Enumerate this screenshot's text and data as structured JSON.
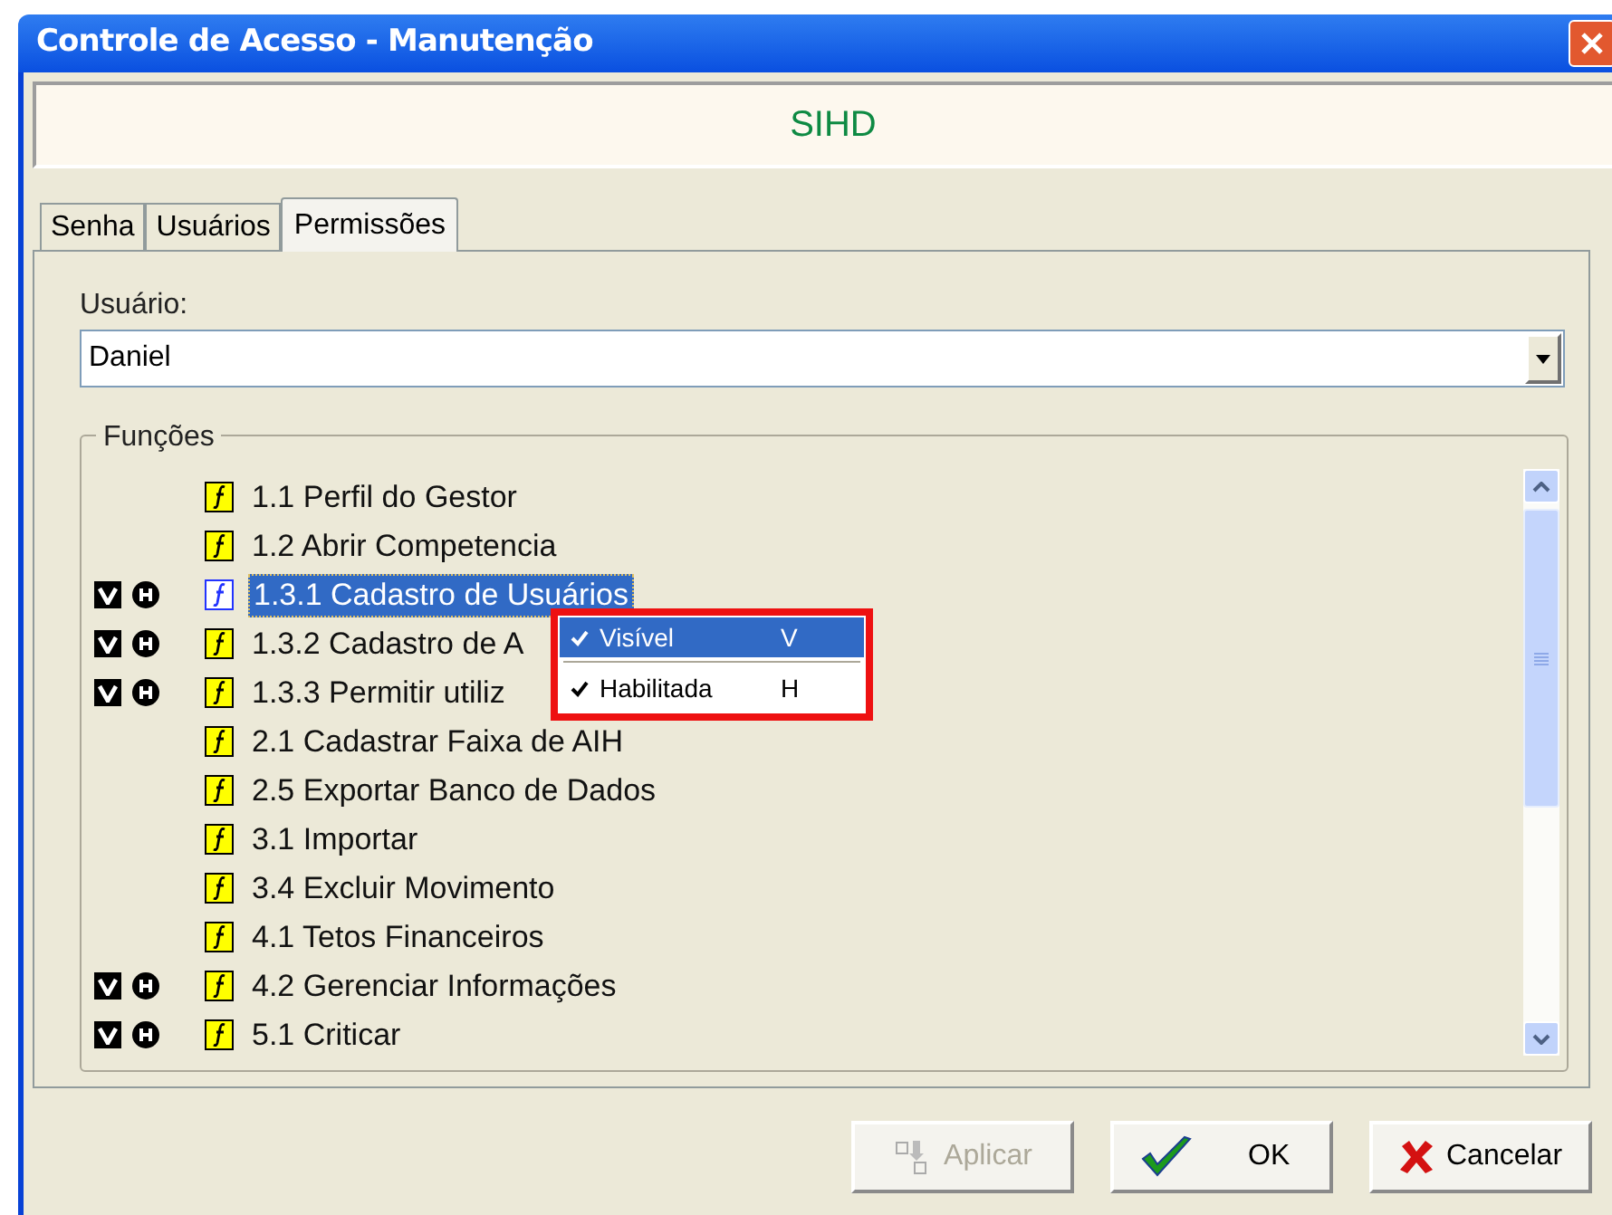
{
  "window": {
    "title": "Controle de Acesso - Manutenção"
  },
  "banner": "SIHD",
  "tabs": [
    {
      "label": "Senha",
      "selected": false
    },
    {
      "label": "Usuários",
      "selected": false
    },
    {
      "label": "Permissões",
      "selected": true
    }
  ],
  "user_field": {
    "label": "Usuário:",
    "value": "Daniel"
  },
  "functions": {
    "title": "Funções",
    "items": [
      {
        "label": "1.1 Perfil do Gestor",
        "visible": false,
        "enabled": false,
        "selected": false
      },
      {
        "label": "1.2 Abrir Competencia",
        "visible": false,
        "enabled": false,
        "selected": false
      },
      {
        "label": "1.3.1 Cadastro de Usuários",
        "visible": true,
        "enabled": true,
        "selected": true
      },
      {
        "label": "1.3.2 Cadastro de A",
        "visible": true,
        "enabled": true,
        "selected": false
      },
      {
        "label": "1.3.3 Permitir utiliz",
        "visible": true,
        "enabled": true,
        "selected": false
      },
      {
        "label": "2.1 Cadastrar Faixa de AIH",
        "visible": false,
        "enabled": false,
        "selected": false
      },
      {
        "label": "2.5 Exportar Banco de Dados",
        "visible": false,
        "enabled": false,
        "selected": false
      },
      {
        "label": "3.1 Importar",
        "visible": false,
        "enabled": false,
        "selected": false
      },
      {
        "label": "3.4 Excluir Movimento",
        "visible": false,
        "enabled": false,
        "selected": false
      },
      {
        "label": "4.1 Tetos Financeiros",
        "visible": false,
        "enabled": false,
        "selected": false
      },
      {
        "label": "4.2 Gerenciar Informações",
        "visible": true,
        "enabled": true,
        "selected": false
      },
      {
        "label": "5.1 Criticar",
        "visible": true,
        "enabled": true,
        "selected": false
      }
    ]
  },
  "context_menu": [
    {
      "label": "Visível",
      "shortcut": "V",
      "checked": true,
      "selected": true
    },
    {
      "label": "Habilitada",
      "shortcut": "H",
      "checked": true,
      "selected": false
    }
  ],
  "buttons": [
    {
      "kind": "apply",
      "label": "Aplicar",
      "disabled": true
    },
    {
      "kind": "ok",
      "label": "OK",
      "disabled": false
    },
    {
      "kind": "cancel",
      "label": "Cancelar",
      "disabled": false
    }
  ]
}
